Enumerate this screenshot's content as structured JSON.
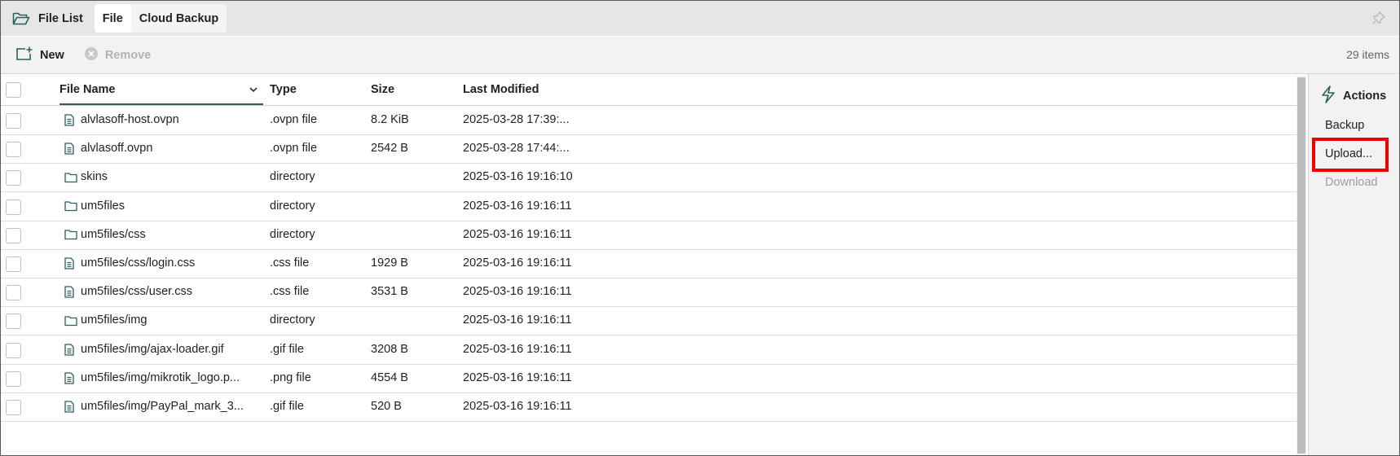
{
  "header": {
    "title": "File List",
    "title_icon": "folder-open-icon",
    "tabs": [
      {
        "label": "File",
        "active": true
      },
      {
        "label": "Cloud Backup",
        "active": false
      }
    ],
    "pin_icon": "pin-icon"
  },
  "toolbar": {
    "new_label": "New",
    "remove_label": "Remove",
    "items_count": "29 items"
  },
  "table": {
    "columns": {
      "name": "File Name",
      "type": "Type",
      "size": "Size",
      "modified": "Last Modified"
    },
    "rows": [
      {
        "name": "alvlasoff-host.ovpn",
        "icon": "file-icon",
        "type": ".ovpn file",
        "size": "8.2 KiB",
        "modified": "2025-03-28 17:39:..."
      },
      {
        "name": "alvlasoff.ovpn",
        "icon": "file-icon",
        "type": ".ovpn file",
        "size": "2542 B",
        "modified": "2025-03-28 17:44:..."
      },
      {
        "name": "skins",
        "icon": "folder-icon",
        "type": "directory",
        "size": "",
        "modified": "2025-03-16 19:16:10"
      },
      {
        "name": "um5files",
        "icon": "folder-icon",
        "type": "directory",
        "size": "",
        "modified": "2025-03-16 19:16:11"
      },
      {
        "name": "um5files/css",
        "icon": "folder-icon",
        "type": "directory",
        "size": "",
        "modified": "2025-03-16 19:16:11"
      },
      {
        "name": "um5files/css/login.css",
        "icon": "file-icon",
        "type": ".css file",
        "size": "1929 B",
        "modified": "2025-03-16 19:16:11"
      },
      {
        "name": "um5files/css/user.css",
        "icon": "file-icon",
        "type": ".css file",
        "size": "3531 B",
        "modified": "2025-03-16 19:16:11"
      },
      {
        "name": "um5files/img",
        "icon": "folder-icon",
        "type": "directory",
        "size": "",
        "modified": "2025-03-16 19:16:11"
      },
      {
        "name": "um5files/img/ajax-loader.gif",
        "icon": "file-icon",
        "type": ".gif file",
        "size": "3208 B",
        "modified": "2025-03-16 19:16:11"
      },
      {
        "name": "um5files/img/mikrotik_logo.p...",
        "icon": "file-icon",
        "type": ".png file",
        "size": "4554 B",
        "modified": "2025-03-16 19:16:11"
      },
      {
        "name": "um5files/img/PayPal_mark_3...",
        "icon": "file-icon",
        "type": ".gif file",
        "size": "520 B",
        "modified": "2025-03-16 19:16:11"
      }
    ]
  },
  "actions": {
    "title": "Actions",
    "icon": "lightning-icon",
    "items": [
      {
        "label": "Backup",
        "disabled": false
      },
      {
        "label": "Upload...",
        "disabled": false,
        "highlighted": true
      },
      {
        "label": "Download",
        "disabled": true
      }
    ]
  },
  "colors": {
    "accent": "#2f5f5b",
    "highlight_border": "#ee0000",
    "header_bg": "#e6e6e6",
    "toolbar_bg": "#f2f2f2"
  }
}
